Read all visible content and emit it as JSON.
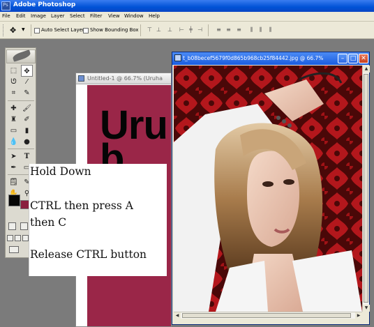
{
  "app": {
    "title": "Adobe Photoshop"
  },
  "menu": [
    "File",
    "Edit",
    "Image",
    "Layer",
    "Select",
    "Filter",
    "View",
    "Window",
    "Help"
  ],
  "options_bar": {
    "auto_select_layer": "Auto Select Layer",
    "show_bounding_box": "Show Bounding Box"
  },
  "untitled_window": {
    "title": "Untitled-1 @ 66.7% (Uruha",
    "canvas_text": "Uru",
    "canvas_text_2": "b",
    "canvas_color": "#9a2648"
  },
  "photo_window": {
    "title": "t_b08becef5679f0d865b968cb25f84442.jpg @ 66.7%"
  },
  "instructions": {
    "line1": "Hold Down",
    "line2": "CTRL then press A",
    "line3": "then C",
    "line4": "Release CTRL button"
  },
  "colors": {
    "foreground": "#070707",
    "background": "#8a1f3e",
    "titlebar": "#0a46c4"
  },
  "icons": [
    "photoshop-logo-icon",
    "move-tool-icon",
    "marquee-icon",
    "lasso-icon",
    "magic-wand-icon",
    "crop-icon",
    "slice-icon",
    "healing-brush-icon",
    "brush-icon",
    "clone-stamp-icon",
    "history-brush-icon",
    "eraser-icon",
    "gradient-icon",
    "blur-icon",
    "dodge-icon",
    "path-selection-icon",
    "type-icon",
    "pen-icon",
    "shape-icon",
    "notes-icon",
    "eyedropper-icon",
    "hand-icon",
    "zoom-icon"
  ]
}
